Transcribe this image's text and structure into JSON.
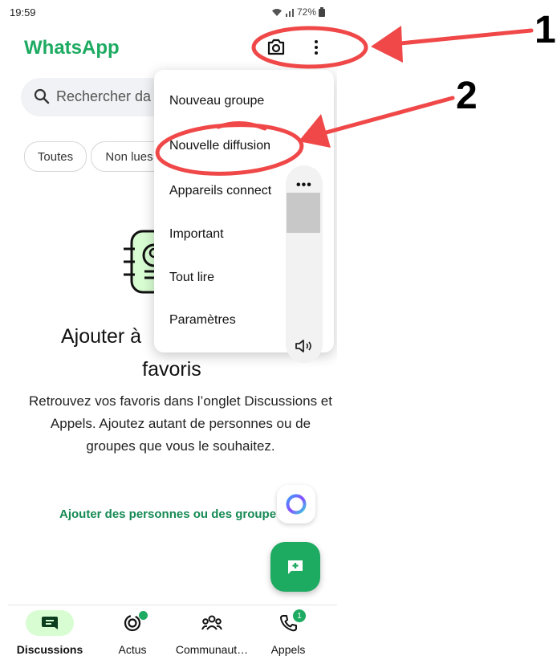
{
  "status_bar": {
    "time": "19:59",
    "battery": "72%"
  },
  "header": {
    "title": "WhatsApp"
  },
  "search": {
    "placeholder": "Rechercher da"
  },
  "filters": [
    "Toutes",
    "Non lues"
  ],
  "menu": {
    "items": [
      "Nouveau groupe",
      "Nouvelle diffusion",
      "Appareils connect",
      "Important",
      "Tout lire",
      "Paramètres"
    ]
  },
  "empty_state": {
    "title_line1": "Ajouter à",
    "title_line2": "favoris",
    "description": "Retrouvez vos favoris dans l’onglet Discussions et Appels. Ajoutez autant de personnes ou de groupes que vous le souhaitez.",
    "link": "Ajouter des personnes ou des groupe"
  },
  "bottom_nav": {
    "items": [
      {
        "label": "Discussions",
        "icon": "chat-icon",
        "active": true
      },
      {
        "label": "Actus",
        "icon": "updates-icon"
      },
      {
        "label": "Communaut…",
        "icon": "communities-icon"
      },
      {
        "label": "Appels",
        "icon": "phone-icon",
        "badge": "1"
      }
    ]
  },
  "annotations": {
    "label_1": "1",
    "label_2": "2",
    "color": "#f04848"
  },
  "colors": {
    "brand_green": "#1daa61",
    "active_tab_bg": "#d8fdd2",
    "link_green": "#158a54"
  }
}
